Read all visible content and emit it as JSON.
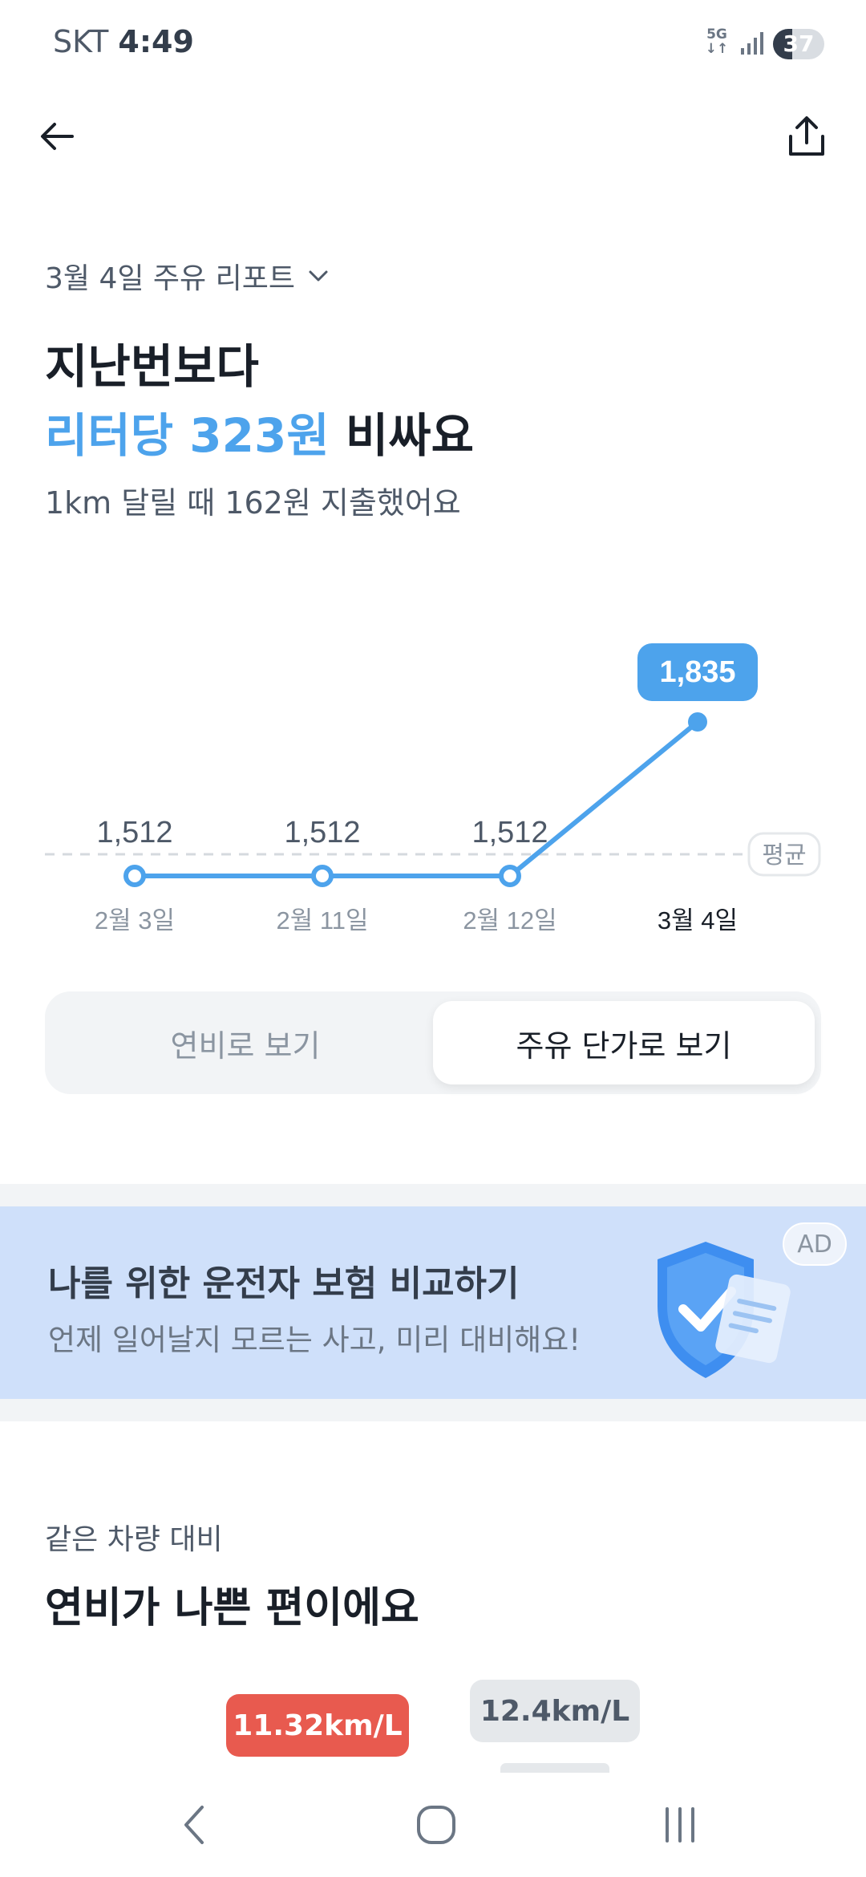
{
  "status_bar": {
    "carrier": "SKT",
    "time": "4:49",
    "network": "5G",
    "battery": "37",
    "battery_level": 0.37
  },
  "app_bar": {
    "back_icon": "arrow-left-icon",
    "share_icon": "share-icon"
  },
  "header": {
    "report_selector": "3월 4일 주유 리포트",
    "headline_line1": "지난번보다",
    "headline_accent": "리터당 323원",
    "headline_rest": " 비싸요",
    "subline": "1km 달릴 때 162원 지출했어요"
  },
  "chart_data": {
    "type": "line",
    "categories": [
      "2월 3일",
      "2월 11일",
      "2월 12일",
      "3월 4일"
    ],
    "values": [
      1512,
      1512,
      1512,
      1835
    ],
    "value_labels": [
      "1,512",
      "1,512",
      "1,512",
      "1,835"
    ],
    "highlight_index": 3,
    "ylim": [
      1480,
      1900
    ],
    "average_label": "평균",
    "average_value": 1560,
    "colors": {
      "line": "#4da3ec",
      "highlight_bg": "#4da3ec",
      "avg_line": "#d5d9de"
    }
  },
  "toggle": {
    "left_label": "연비로 보기",
    "right_label": "주유 단가로 보기",
    "selected": "right"
  },
  "ad": {
    "title": "나를 위한 운전자 보험 비교하기",
    "subtitle": "언제 일어날지 모르는 사고, 미리 대비해요!",
    "badge": "AD",
    "illustration_icon": "shield-check-icon"
  },
  "comparison": {
    "label": "같은 차량 대비",
    "title": "연비가 나쁜 편이에요",
    "mine_value": "11.32km/L",
    "average_value": "12.4km/L"
  },
  "nav_bar": {
    "back_icon": "nav-back-icon",
    "home_icon": "nav-home-icon",
    "recent_icon": "nav-recent-apps-icon"
  }
}
